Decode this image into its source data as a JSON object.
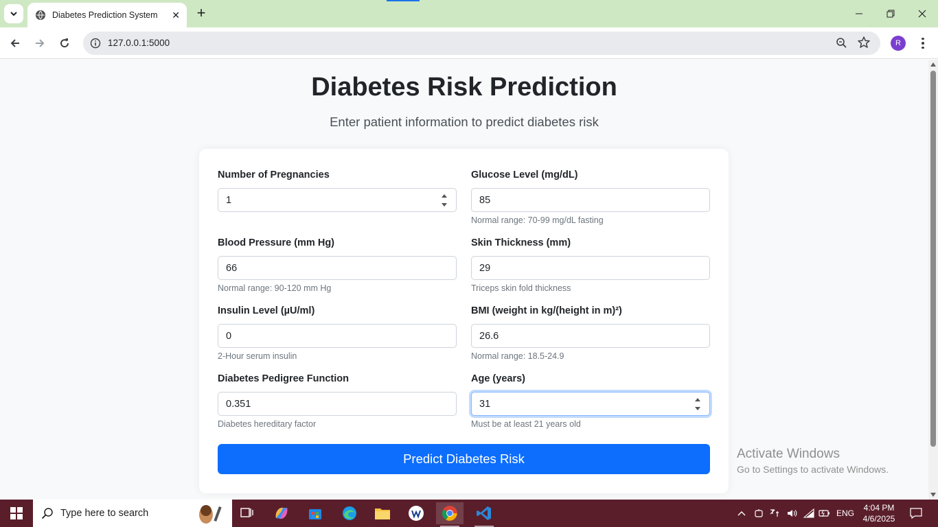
{
  "browser": {
    "tab_title": "Diabetes Prediction System",
    "new_tab": "+",
    "url": "127.0.0.1:5000",
    "profile_initial": "R"
  },
  "page": {
    "title": "Diabetes Risk Prediction",
    "subtitle": "Enter patient information to predict diabetes risk",
    "fields": [
      {
        "label": "Number of Pregnancies",
        "value": "1",
        "help": ""
      },
      {
        "label": "Glucose Level (mg/dL)",
        "value": "85",
        "help": "Normal range: 70-99 mg/dL fasting"
      },
      {
        "label": "Blood Pressure (mm Hg)",
        "value": "66",
        "help": "Normal range: 90-120 mm Hg"
      },
      {
        "label": "Skin Thickness (mm)",
        "value": "29",
        "help": "Triceps skin fold thickness"
      },
      {
        "label": "Insulin Level (µU/ml)",
        "value": "0",
        "help": "2-Hour serum insulin"
      },
      {
        "label": "BMI (weight in kg/(height in m)²)",
        "value": "26.6",
        "help": "Normal range: 18.5-24.9"
      },
      {
        "label": "Diabetes Pedigree Function",
        "value": "0.351",
        "help": "Diabetes hereditary factor"
      },
      {
        "label": "Age (years)",
        "value": "31",
        "help": "Must be at least 21 years old"
      }
    ],
    "submit_label": "Predict Diabetes Risk"
  },
  "watermark": {
    "line1": "Activate Windows",
    "line2": "Go to Settings to activate Windows."
  },
  "taskbar": {
    "search_placeholder": "Type here to search",
    "language": "ENG",
    "time": "4:04 PM",
    "date": "4/6/2025"
  },
  "colors": {
    "primary": "#0d6efd",
    "tabstrip": "#cfe8c4",
    "taskbar": "#5a1e2b"
  }
}
